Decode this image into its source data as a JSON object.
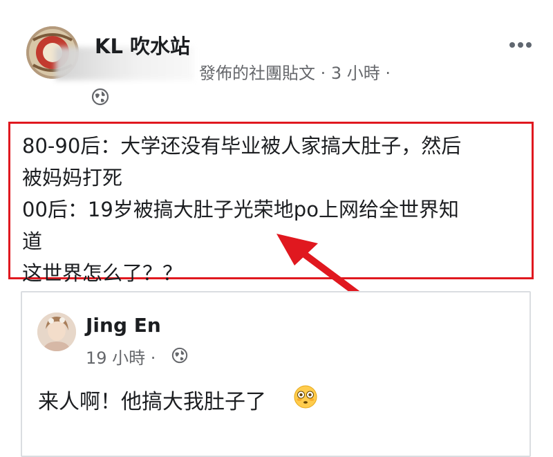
{
  "post": {
    "group_name": "KL 吹水站",
    "meta": "發佈的社團貼文 · 3 小時 ·",
    "icons": [
      "avatar",
      "globe-icon",
      "more-options-icon"
    ],
    "text_lines": [
      "80-90后：大学还没有毕业被人家搞大肚子，然后",
      "被妈妈打死",
      "00后：19岁被搞大肚子光荣地po上网给全世界知",
      "道",
      "这世界怎么了？？"
    ],
    "highlight_color": "#e0181f"
  },
  "shared": {
    "author": "Jing En",
    "meta": "19 小時 ·",
    "text": "来人啊！他搞大我肚子了",
    "emoji": "flushed-face-icon"
  }
}
